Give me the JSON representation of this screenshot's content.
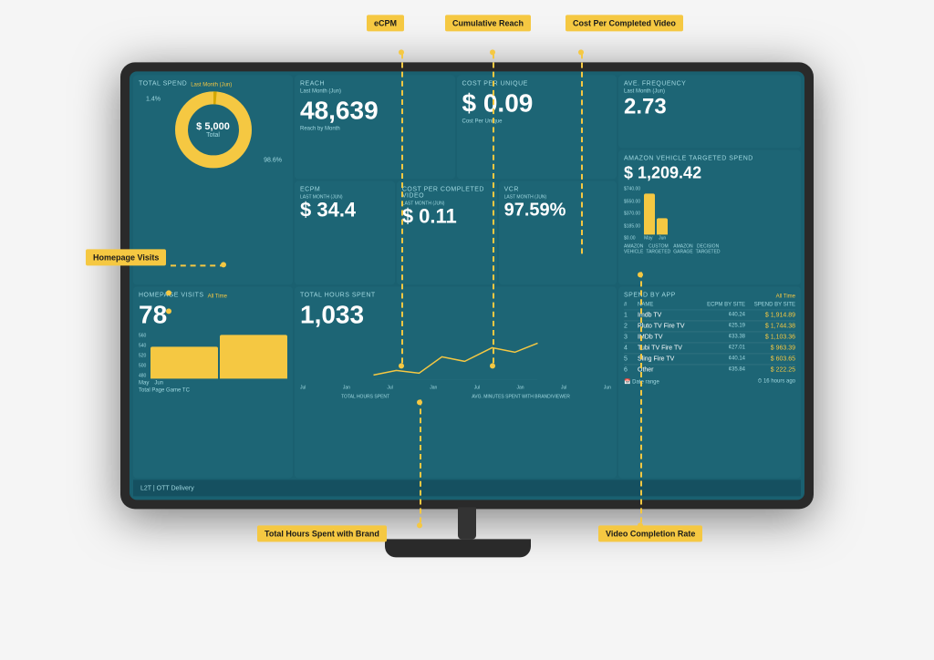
{
  "annotations": {
    "ecpm": "eCPM",
    "cumulative_reach": "Cumulative Reach",
    "cost_per_completed_video": "Cost Per Completed Video",
    "homepage_visits": "Homepage Visits",
    "total_hours_spent": "Total Hours Spent with Brand",
    "video_completion_rate": "Video Completion Rate"
  },
  "dashboard": {
    "total_spend": {
      "label": "TOTAL SPEND",
      "period": "Last Month (Jun)",
      "value": "$ 5,000",
      "sublabel": "Total",
      "pct1": "1.4%",
      "pct2": "98.6%"
    },
    "reach": {
      "label": "REACH",
      "sublabel": "Last Month (Jun)",
      "value": "48,639",
      "sub": "Reach by Month"
    },
    "cost_per_unique": {
      "label": "COST PER UNIQUE",
      "value": "$ 0.09",
      "sub": "Cost Per Unique"
    },
    "avg_frequency": {
      "label": "AVE. FREQUENCY",
      "sublabel": "Last Month (Jun)",
      "value": "2.73"
    },
    "amazon_vehicle": {
      "label": "AMAZON VEHICLE TARGETED SPEND",
      "value": "$ 1,209.42"
    },
    "ecpm": {
      "label": "eCPM",
      "sublabel": "LAST MONTH (JUN)",
      "value": "$ 34.4"
    },
    "cost_per_completed_video": {
      "label": "COST PER COMPLETED VIDEO",
      "sublabel": "LAST MONTH (JUN)",
      "value": "$ 0.11"
    },
    "vcr": {
      "label": "VCR",
      "sublabel": "LAST MONTH (JUN)",
      "value": "97.59%"
    },
    "homepage_visits": {
      "label": "HOMEPAGE VISITS",
      "period": "All Time",
      "value": "78"
    },
    "total_hours_spent": {
      "label": "TOTAL HOURS SPENT",
      "value": "1,033",
      "sub1": "TOTAL HOURS SPENT",
      "sub2": "AVG. MINUTES SPENT WITH BRAND/VIEWER"
    },
    "spend_by_app": {
      "label": "SPEND BY APP",
      "period": "All Time",
      "headers": [
        "#",
        "NAME",
        "ECPM BY SITE",
        "SPEND BY SITE"
      ],
      "rows": [
        {
          "num": "1",
          "name": "Imdb TV",
          "ecpm": "¢40.24",
          "spend": "$ 1,914.89"
        },
        {
          "num": "2",
          "name": "Pluto TV Fire TV",
          "ecpm": "¢25.19",
          "spend": "$ 1,744.38"
        },
        {
          "num": "3",
          "name": "IMDb TV",
          "ecpm": "¢33.38",
          "spend": "$ 1,103.36"
        },
        {
          "num": "4",
          "name": "Tubi TV Fire TV",
          "ecpm": "¢27.01",
          "spend": "$ 963.39"
        },
        {
          "num": "5",
          "name": "Sling Fire TV",
          "ecpm": "¢40.14",
          "spend": "$ 603.65"
        },
        {
          "num": "6",
          "name": "Other",
          "ecpm": "¢35.84",
          "spend": "$ 222.25"
        }
      ]
    },
    "footer": {
      "logo": "L2T | OTT Delivery"
    },
    "amazon_chart": {
      "labels": [
        "May",
        "Jun"
      ],
      "y_labels": [
        "$740.00",
        "$550.00",
        "$370.00",
        "$185.00",
        "$0.00"
      ],
      "categories": [
        "AMAZON VEHICLE",
        "CUSTOM TARGETED",
        "AMAZON GARAGE",
        "DECISION TARGETED"
      ]
    }
  }
}
